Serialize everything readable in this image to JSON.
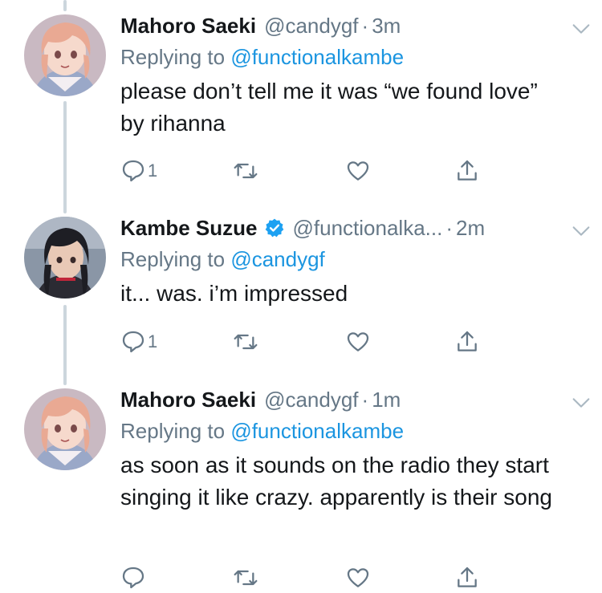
{
  "tweets": [
    {
      "name": "Mahoro Saeki",
      "handle": "@candygf",
      "time": "3m",
      "verified": false,
      "replying_prefix": "Replying to",
      "replying_to": "@functionalkambe",
      "text": "please don’t tell me it was “we found love” by rihanna",
      "reply_count": "1",
      "avatar_icon": "anime-girl-pink-hair-avatar"
    },
    {
      "name": "Kambe Suzue",
      "handle": "@functionalka...",
      "time": "2m",
      "verified": true,
      "replying_prefix": "Replying to",
      "replying_to": "@candygf",
      "text": "it... was. i’m impressed",
      "reply_count": "1",
      "avatar_icon": "anime-girl-dark-hair-avatar"
    },
    {
      "name": "Mahoro Saeki",
      "handle": "@candygf",
      "time": "1m",
      "verified": false,
      "replying_prefix": "Replying to",
      "replying_to": "@functionalkambe",
      "text": "as soon as it sounds on the radio they start singing it like crazy. apparently is their song",
      "reply_count": "",
      "avatar_icon": "anime-girl-pink-hair-avatar"
    }
  ],
  "separator": "·",
  "colors": {
    "primary_text": "#14171a",
    "secondary_text": "#657786",
    "link": "#1b95e0",
    "thread_line": "#ccd6dd",
    "verified_badge": "#1da1f2"
  }
}
